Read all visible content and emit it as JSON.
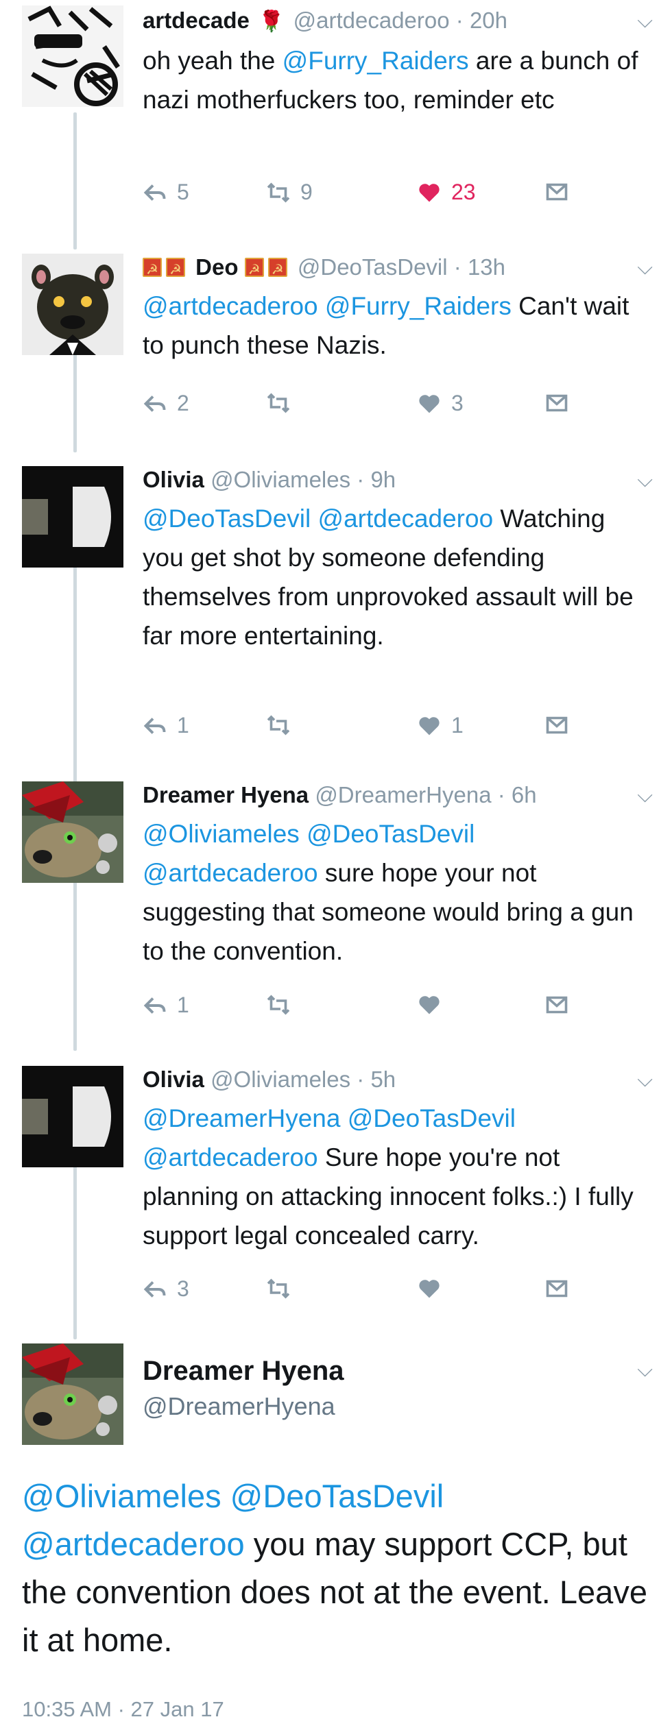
{
  "tweets": [
    {
      "name": "artdecade",
      "handle": "@artdecaderoo",
      "time": "20h",
      "segments": [
        {
          "t": "oh yeah the "
        },
        {
          "t": "@Furry_Raiders",
          "m": true
        },
        {
          "t": " are a bunch of nazi motherfuckers too, reminder etc"
        }
      ],
      "replies": "5",
      "retweets": "9",
      "likes": "23",
      "liked": true
    },
    {
      "name": "Deo",
      "handle": "@DeoTasDevil",
      "time": "13h",
      "segments": [
        {
          "t": "@artdecaderoo",
          "m": true
        },
        {
          "t": " "
        },
        {
          "t": "@Furry_Raiders",
          "m": true
        },
        {
          "t": " Can't wait to punch these Nazis."
        }
      ],
      "replies": "2",
      "retweets": "",
      "likes": "3",
      "liked": false
    },
    {
      "name": "Olivia",
      "handle": "@Oliviameles",
      "time": "9h",
      "segments": [
        {
          "t": "@DeoTasDevil",
          "m": true
        },
        {
          "t": " "
        },
        {
          "t": "@artdecaderoo",
          "m": true
        },
        {
          "t": " Watching you get shot by someone defending themselves from unprovoked assault will be far more entertaining."
        }
      ],
      "replies": "1",
      "retweets": "",
      "likes": "1",
      "liked": false
    },
    {
      "name": "Dreamer Hyena",
      "handle": "@DreamerHyena",
      "time": "6h",
      "segments": [
        {
          "t": "@Oliviameles",
          "m": true
        },
        {
          "t": " "
        },
        {
          "t": "@DeoTasDevil",
          "m": true
        },
        {
          "t": " "
        },
        {
          "t": "@artdecaderoo",
          "m": true
        },
        {
          "t": " sure hope your not suggesting that someone would bring a gun to the convention."
        }
      ],
      "replies": "1",
      "retweets": "",
      "likes": "",
      "liked": false
    },
    {
      "name": "Olivia",
      "handle": "@Oliviameles",
      "time": "5h",
      "segments": [
        {
          "t": "@DreamerHyena",
          "m": true
        },
        {
          "t": " "
        },
        {
          "t": "@DeoTasDevil",
          "m": true
        },
        {
          "t": " "
        },
        {
          "t": "@artdecaderoo",
          "m": true
        },
        {
          "t": " Sure hope you're not planning on attacking innocent folks.:) I fully support legal concealed carry."
        }
      ],
      "replies": "3",
      "retweets": "",
      "likes": "",
      "liked": false
    }
  ],
  "main_tweet": {
    "name": "Dreamer Hyena",
    "handle": "@DreamerHyena",
    "segments": [
      {
        "t": "@Oliviameles",
        "m": true
      },
      {
        "t": " "
      },
      {
        "t": "@DeoTasDevil",
        "m": true
      },
      {
        "t": " "
      },
      {
        "t": "@artdecaderoo",
        "m": true
      },
      {
        "t": " you may support CCP, but the convention does not at the event. Leave it at home."
      }
    ],
    "timestamp": "10:35 AM · 27 Jan 17"
  },
  "icons": {
    "reply": "reply-icon",
    "retweet": "retweet-icon",
    "like": "heart-icon",
    "dm": "direct-message-icon",
    "more": "chevron-down-icon"
  },
  "colors": {
    "mention": "#1b95e0",
    "like_active": "#e0245e",
    "muted": "#8899a6"
  }
}
